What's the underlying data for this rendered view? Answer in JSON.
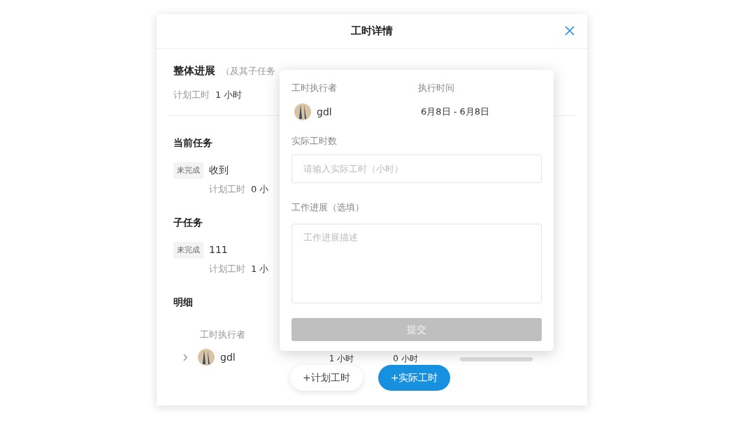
{
  "dialog": {
    "title": "工时详情"
  },
  "overall": {
    "heading": "整体进展",
    "note": "（及其子任务",
    "planned_label": "计划工时",
    "planned_value": "1 小时"
  },
  "current_task": {
    "heading": "当前任务",
    "tasks": [
      {
        "status": "未完成",
        "name": "收到",
        "planned_label": "计划工时",
        "planned_value": "0 小"
      }
    ]
  },
  "subtasks": {
    "heading": "子任务",
    "tasks": [
      {
        "status": "未完成",
        "name": "111",
        "planned_label": "计划工时",
        "planned_value": "1 小"
      }
    ]
  },
  "details": {
    "heading": "明细",
    "columns": [
      "工时执行者"
    ],
    "rows": [
      {
        "expanded": false,
        "assignee": "gdl",
        "planned": "1 小时",
        "actual": "0 小时",
        "level": 0
      }
    ]
  },
  "popover": {
    "assignee_label": "工时执行者",
    "assignee": "gdl",
    "time_label": "执行时间",
    "time_value": "6月8日 - 6月8日",
    "hours_label": "实际工时数",
    "hours_placeholder": "请输入实际工时（小时）",
    "progress_label": "工作进展（选填）",
    "progress_placeholder": "工作进展描述",
    "submit": {
      "label": "提交",
      "disabled": true
    }
  },
  "actions": [
    {
      "label": "+计划工时",
      "kind": "secondary"
    },
    {
      "label": "+实际工时",
      "kind": "primary"
    }
  ]
}
